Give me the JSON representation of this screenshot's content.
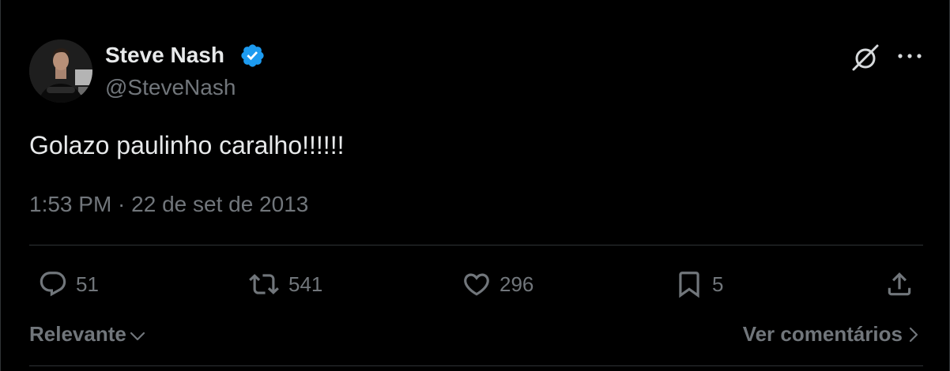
{
  "author": {
    "name": "Steve Nash",
    "handle": "@SteveNash",
    "verified": true
  },
  "tweet": {
    "text": "Golazo paulinho caralho!!!!!!",
    "meta": "1:53 PM · 22 de set de 2013"
  },
  "actions": {
    "replies": "51",
    "retweets": "541",
    "likes": "296",
    "bookmarks": "5"
  },
  "footer": {
    "sort_label": "Relevante",
    "view_comments_label": "Ver comentários"
  },
  "colors": {
    "background": "#000000",
    "text_primary": "#e7e9ea",
    "text_secondary": "#71767b",
    "divider": "#2f3336",
    "verified_badge": "#1d9bf0"
  },
  "icons": {
    "verified": "verified-badge-icon",
    "grok": "grok-icon",
    "more": "more-horizontal-icon",
    "reply": "reply-icon",
    "retweet": "retweet-icon",
    "like": "heart-icon",
    "bookmark": "bookmark-icon",
    "share": "share-icon",
    "sort_chevron": "chevron-down-icon",
    "comments_chevron": "chevron-right-icon"
  }
}
